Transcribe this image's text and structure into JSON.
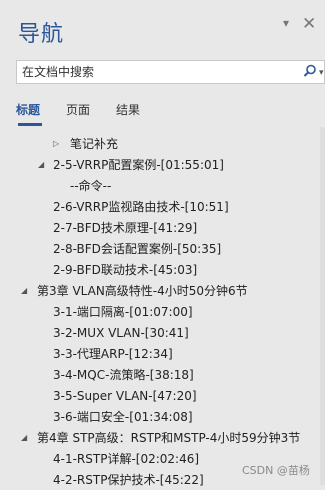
{
  "pane": {
    "title": "导航",
    "menu_icon": "▾",
    "close_icon": "✕"
  },
  "search": {
    "placeholder": "在文档中搜索",
    "search_icon": "search-icon",
    "dropdown_icon": "▾"
  },
  "tabs": [
    {
      "label": "标题",
      "active": true
    },
    {
      "label": "页面",
      "active": false
    },
    {
      "label": "结果",
      "active": false
    }
  ],
  "tree": [
    {
      "text": "笔记补充",
      "toggle": "▷",
      "level": 2
    },
    {
      "text": "2-5-VRRP配置案例-[01:55:01]",
      "toggle": "◢",
      "level": 1
    },
    {
      "text": "--命令--",
      "toggle": "",
      "level": 3
    },
    {
      "text": "2-6-VRRP监视路由技术-[10:51]",
      "toggle": "",
      "level": 1
    },
    {
      "text": "2-7-BFD技术原理-[41:29]",
      "toggle": "",
      "level": 1
    },
    {
      "text": "2-8-BFD会话配置案例-[50:35]",
      "toggle": "",
      "level": 1
    },
    {
      "text": "2-9-BFD联动技术-[45:03]",
      "toggle": "",
      "level": 1
    },
    {
      "text": "第3章 VLAN高级特性-4小时50分钟6节",
      "toggle": "◢",
      "level": 0
    },
    {
      "text": "3-1-端口隔离-[01:07:00]",
      "toggle": "",
      "level": 1
    },
    {
      "text": "3-2-MUX VLAN-[30:41]",
      "toggle": "",
      "level": 1
    },
    {
      "text": "3-3-代理ARP-[12:34]",
      "toggle": "",
      "level": 1
    },
    {
      "text": "3-4-MQC-流策略-[38:18]",
      "toggle": "",
      "level": 1
    },
    {
      "text": "3-5-Super VLAN-[47:20]",
      "toggle": "",
      "level": 1
    },
    {
      "text": "3-6-端口安全-[01:34:08]",
      "toggle": "",
      "level": 1
    },
    {
      "text": "第4章 STP高级：RSTP和MSTP-4小时59分钟3节",
      "toggle": "◢",
      "level": 0
    },
    {
      "text": "4-1-RSTP详解-[02:02:46]",
      "toggle": "",
      "level": 1
    },
    {
      "text": "4-2-RSTP保护技术-[45:22]",
      "toggle": "",
      "level": 1
    }
  ],
  "watermark": "CSDN @苗杨",
  "colors": {
    "accent": "#2b579a",
    "pane_bg": "#e8e8e8"
  }
}
